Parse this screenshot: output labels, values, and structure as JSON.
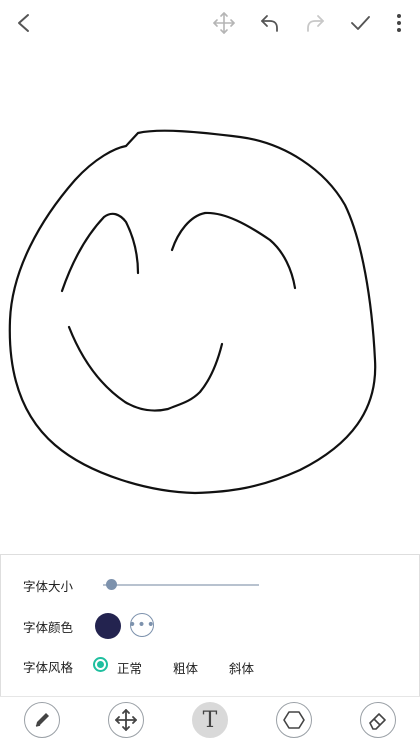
{
  "topbar": {
    "back_icon": "chevron-left-icon",
    "move_icon": "move-arrows-icon",
    "undo_icon": "undo-icon",
    "redo_icon": "redo-icon",
    "confirm_icon": "check-icon",
    "menu_icon": "more-vertical-icon"
  },
  "settings": {
    "font_size_label": "字体大小",
    "font_size_level": 0.05,
    "font_color_label": "字体颜色",
    "font_color": "#23234f",
    "font_style_label": "字体风格",
    "style_options": [
      "正常",
      "粗体",
      "斜体"
    ],
    "selected_style": "正常"
  },
  "toolbar": {
    "tools": [
      "pen-icon",
      "move-arrows-icon",
      "text-icon",
      "shape-hexagon-icon",
      "eraser-icon"
    ],
    "active_tool": "text-icon",
    "text_glyph": "T"
  },
  "colors": {
    "accent": "#1fbf9f",
    "slider": "#7d92ad"
  }
}
